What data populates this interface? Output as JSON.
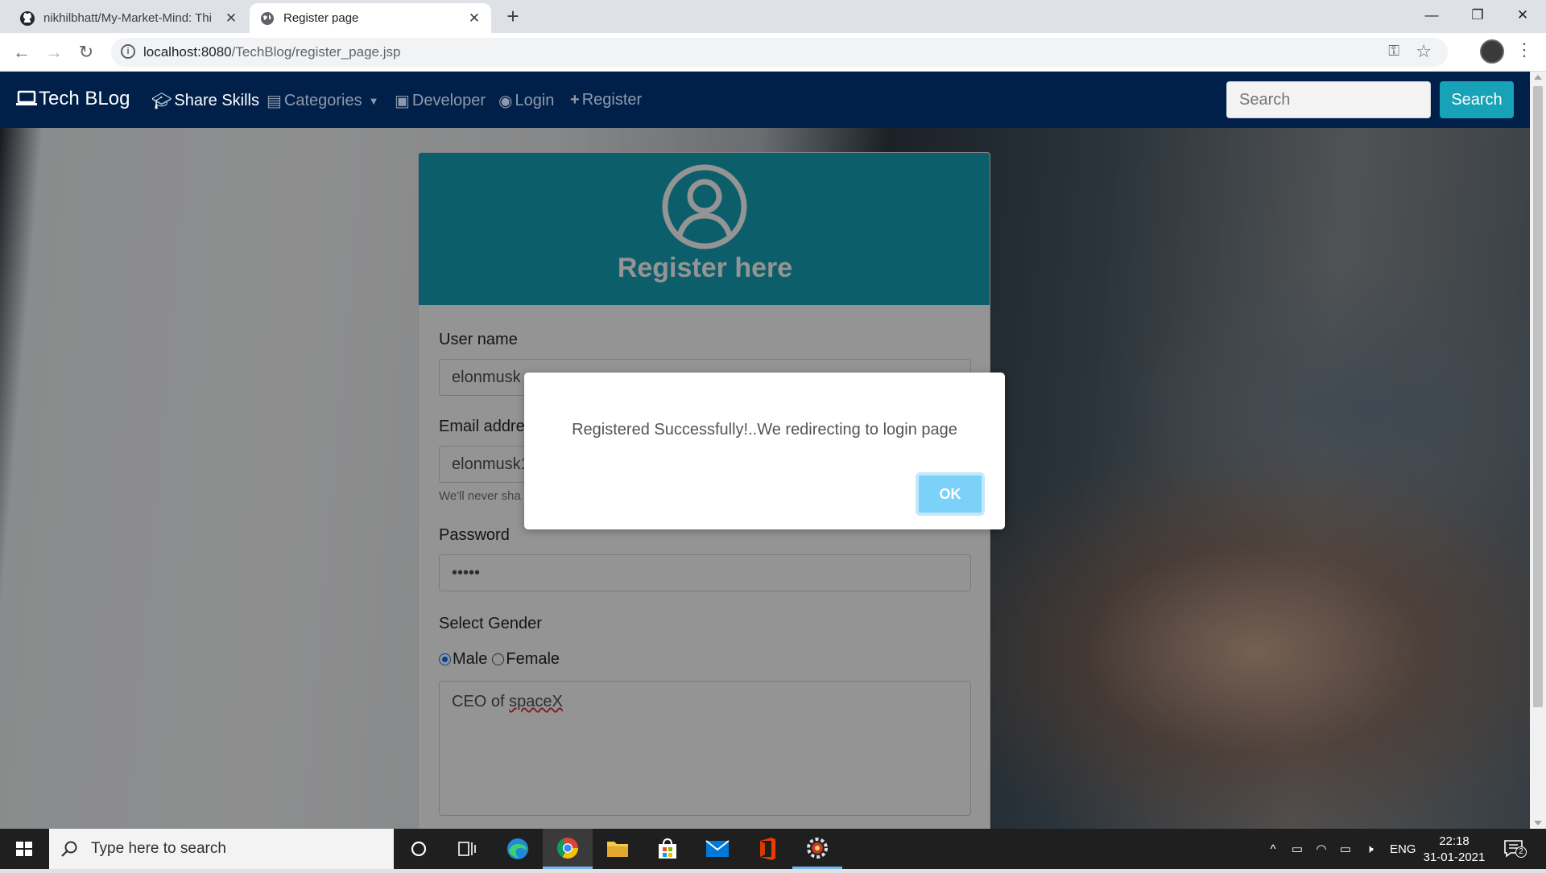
{
  "browser": {
    "tabs": [
      {
        "title": "nikhilbhatt/My-Market-Mind: Thi",
        "icon": "github-icon"
      },
      {
        "title": "Register page",
        "icon": "globe-icon"
      }
    ],
    "url_host": "localhost:8080",
    "url_path": "/TechBlog/register_page.jsp"
  },
  "site_nav": {
    "brand": "Tech BLog",
    "items": [
      {
        "label": "Share Skills",
        "icon": "graduation-cap-icon"
      },
      {
        "label": "Categories",
        "icon": "book-icon"
      },
      {
        "label": "Developer",
        "icon": "linkedin-icon"
      },
      {
        "label": "Login",
        "icon": "user-circle-icon"
      },
      {
        "label": "Register",
        "icon": "plus-icon"
      }
    ],
    "search_placeholder": "Search",
    "search_button": "Search"
  },
  "register_form": {
    "title": "Register here",
    "username_label": "User name",
    "username_value": "elonmusk",
    "email_label": "Email addres",
    "email_value": "elonmusk1",
    "email_help": "We'll never sha",
    "password_label": "Password",
    "password_value": "•••••",
    "gender_label": "Select Gender",
    "gender_options": [
      "Male",
      "Female"
    ],
    "gender_selected": "Male",
    "about_value_prefix": "CEO of ",
    "about_value_word": "spaceX"
  },
  "alert": {
    "message": "Registered Successfully!..We redirecting to login page",
    "ok_label": "OK"
  },
  "taskbar": {
    "search_placeholder": "Type here to search",
    "language": "ENG",
    "time": "22:18",
    "date": "31-01-2021",
    "notification_count": "2"
  }
}
